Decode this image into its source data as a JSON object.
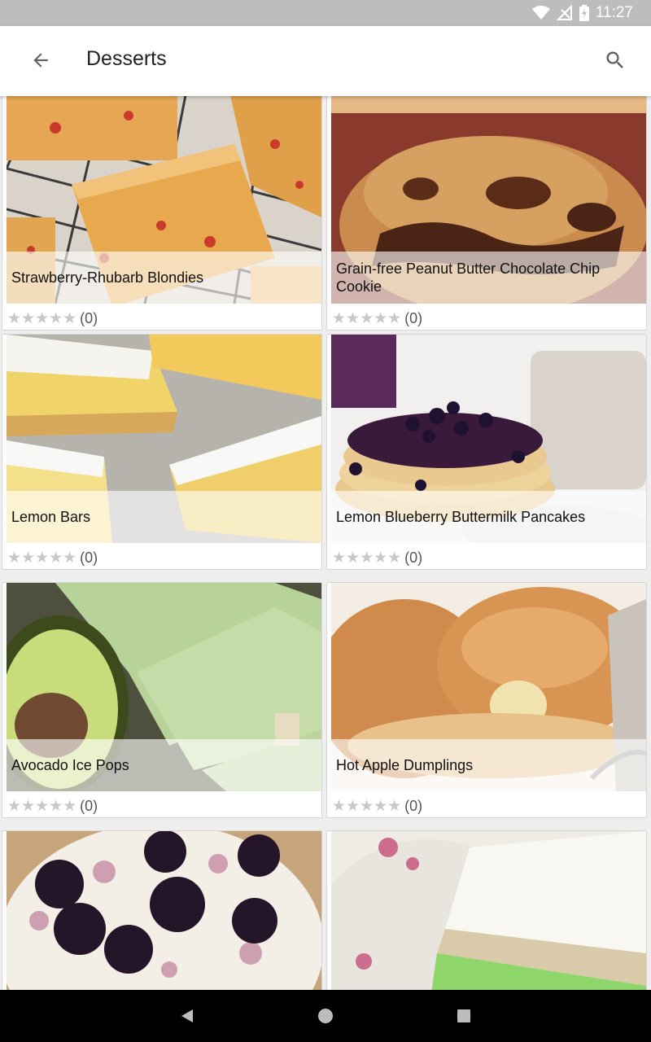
{
  "status_bar": {
    "time": "11:27",
    "icons": [
      "wifi-icon",
      "no-signal-icon",
      "battery-icon"
    ]
  },
  "app_bar": {
    "title": "Desserts",
    "back_icon": "arrow-back-icon",
    "search_icon": "search-icon"
  },
  "recipes": [
    {
      "title": "Strawberry-Rhubarb Blondies",
      "rating_count": "(0)",
      "stars": 0
    },
    {
      "title": "Grain-free Peanut Butter Chocolate Chip Cookie",
      "rating_count": "(0)",
      "stars": 0
    },
    {
      "title": "Lemon Bars",
      "rating_count": "(0)",
      "stars": 0
    },
    {
      "title": "Lemon Blueberry Buttermilk Pancakes",
      "rating_count": "(0)",
      "stars": 0
    },
    {
      "title": "Avocado Ice Pops",
      "rating_count": "(0)",
      "stars": 0
    },
    {
      "title": "Hot Apple Dumplings",
      "rating_count": "(0)",
      "stars": 0
    },
    {
      "title": "",
      "rating_count": "",
      "stars": 0
    },
    {
      "title": "",
      "rating_count": "",
      "stars": 0
    }
  ],
  "nav_bar": {
    "back": "nav-back-icon",
    "home": "nav-home-icon",
    "recents": "nav-recents-icon"
  }
}
